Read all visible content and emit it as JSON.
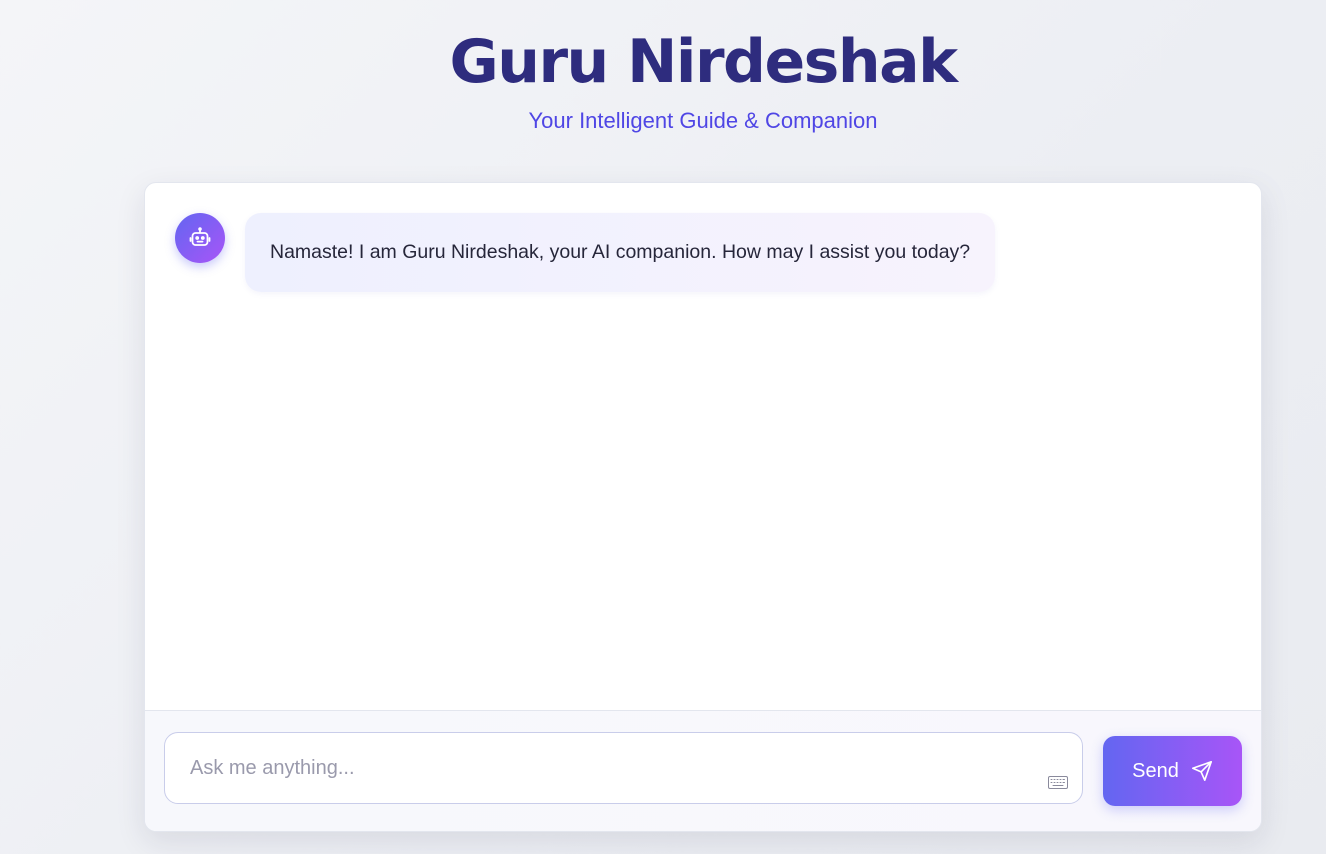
{
  "header": {
    "title": "Guru Nirdeshak",
    "subtitle": "Your Intelligent Guide & Companion"
  },
  "chat": {
    "messages": [
      {
        "sender": "bot",
        "avatar_icon": "robot-icon",
        "text": "Namaste! I am Guru Nirdeshak, your AI companion. How may I assist you today?"
      }
    ]
  },
  "composer": {
    "placeholder": "Ask me anything...",
    "value": "",
    "keyboard_icon": "keyboard-icon",
    "send_label": "Send",
    "send_icon": "paper-plane-icon"
  },
  "colors": {
    "title": "#2e2c7e",
    "accent": "#4f46e5",
    "gradient_start": "#6366f1",
    "gradient_end": "#a855f7"
  }
}
